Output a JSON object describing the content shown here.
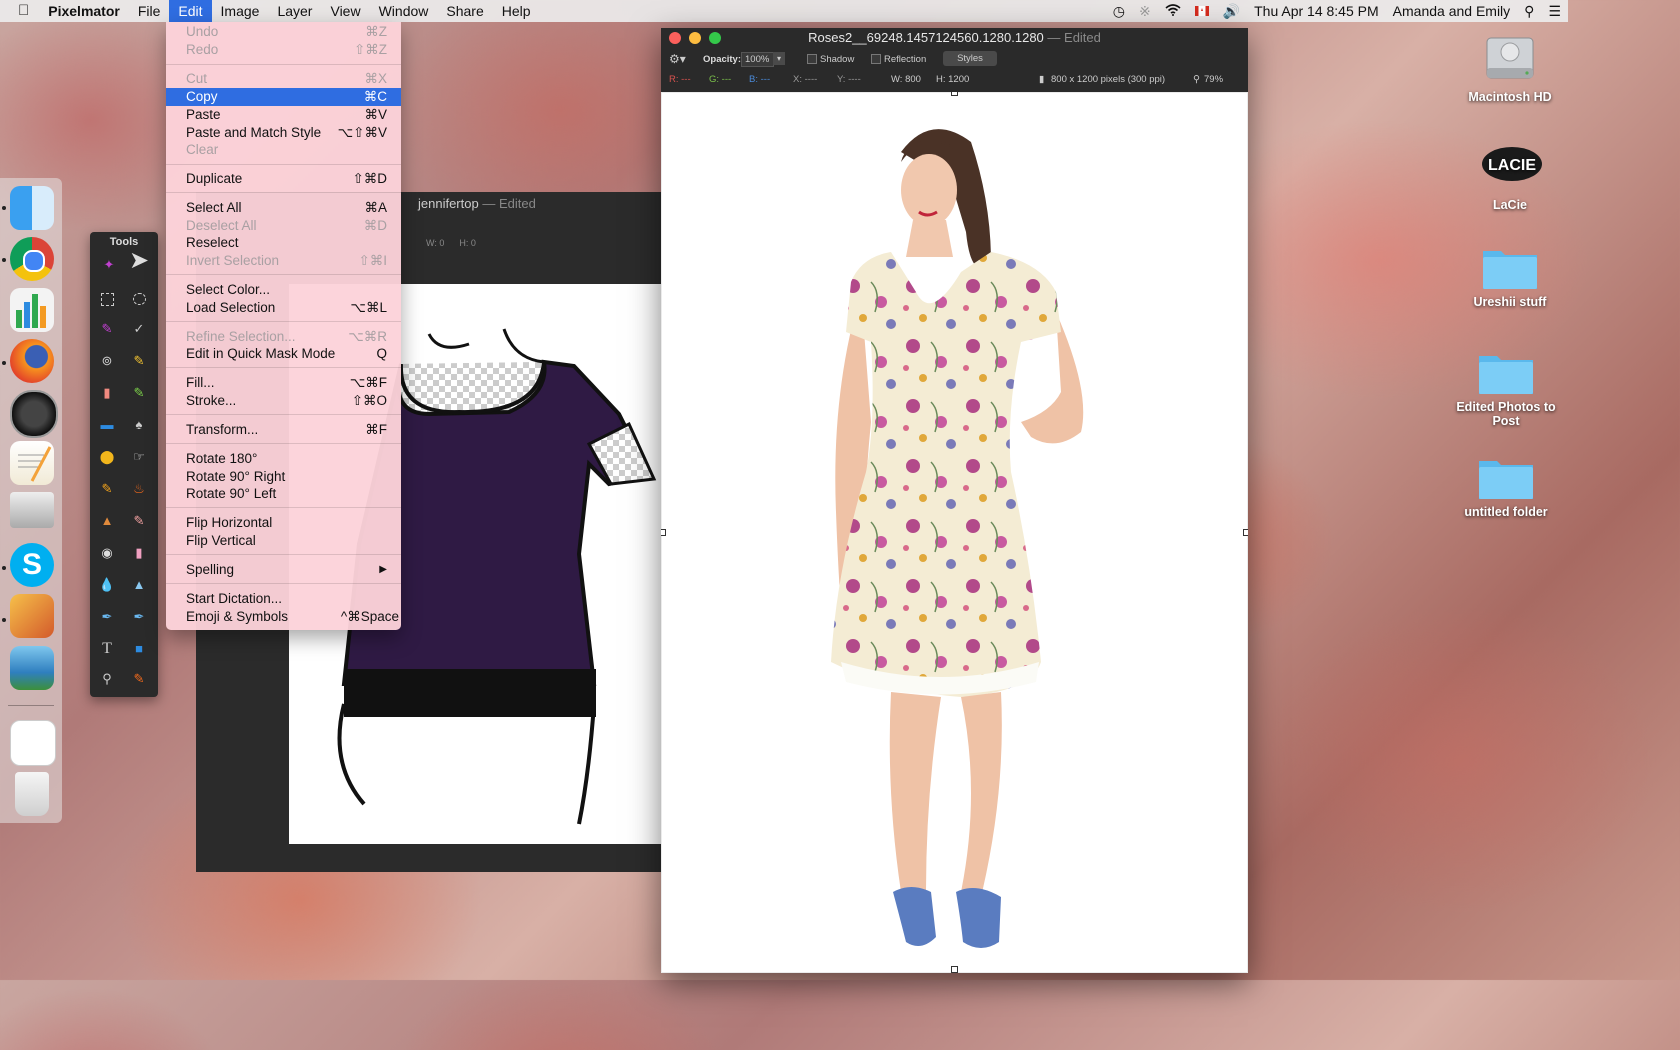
{
  "menubar": {
    "apple": "",
    "app": "Pixelmator",
    "items": [
      "File",
      "Edit",
      "Image",
      "Layer",
      "View",
      "Window",
      "Share",
      "Help"
    ],
    "active": "Edit",
    "clock": "Thu Apr 14  8:45 PM",
    "user": "Amanda and Emily"
  },
  "edit_menu": {
    "items": [
      {
        "label": "Undo",
        "shortcut": "⌘Z",
        "disabled": true
      },
      {
        "label": "Redo",
        "shortcut": "⇧⌘Z",
        "disabled": true
      },
      {
        "label": "Cut",
        "shortcut": "⌘X",
        "disabled": true
      },
      {
        "label": "Copy",
        "shortcut": "⌘C",
        "selected": true
      },
      {
        "label": "Paste",
        "shortcut": "⌘V"
      },
      {
        "label": "Paste and Match Style",
        "shortcut": "⌥⇧⌘V"
      },
      {
        "label": "Clear",
        "shortcut": "",
        "disabled": true
      },
      {
        "label": "Duplicate",
        "shortcut": "⇧⌘D"
      },
      {
        "label": "Select All",
        "shortcut": "⌘A"
      },
      {
        "label": "Deselect All",
        "shortcut": "⌘D",
        "disabled": true
      },
      {
        "label": "Reselect",
        "shortcut": ""
      },
      {
        "label": "Invert Selection",
        "shortcut": "⇧⌘I",
        "disabled": true
      },
      {
        "label": "Select Color...",
        "shortcut": ""
      },
      {
        "label": "Load Selection",
        "shortcut": "⌥⌘L"
      },
      {
        "label": "Refine Selection...",
        "shortcut": "⌥⌘R",
        "disabled": true
      },
      {
        "label": "Edit in Quick Mask Mode",
        "shortcut": "Q"
      },
      {
        "label": "Fill...",
        "shortcut": "⌥⌘F"
      },
      {
        "label": "Stroke...",
        "shortcut": "⇧⌘O"
      },
      {
        "label": "Transform...",
        "shortcut": "⌘F"
      },
      {
        "label": "Rotate 180°",
        "shortcut": ""
      },
      {
        "label": "Rotate 90° Right",
        "shortcut": ""
      },
      {
        "label": "Rotate 90° Left",
        "shortcut": ""
      },
      {
        "label": "Flip Horizontal",
        "shortcut": ""
      },
      {
        "label": "Flip Vertical",
        "shortcut": ""
      },
      {
        "label": "Spelling",
        "shortcut": "▶"
      },
      {
        "label": "Start Dictation...",
        "shortcut": ""
      },
      {
        "label": "Emoji & Symbols",
        "shortcut": "^⌘Space"
      }
    ]
  },
  "tools_palette": {
    "title": "Tools"
  },
  "back_window": {
    "title": "jennifertop",
    "edited": "— Edited",
    "w": "W: 0",
    "h": "H: 0"
  },
  "main_window": {
    "title": "Roses2__69248.1457124560.1280.1280",
    "edited": "— Edited",
    "opacity_label": "Opacity:",
    "opacity_value": "100%",
    "shadow": "Shadow",
    "reflection": "Reflection",
    "styles": "Styles",
    "r": "R: ---",
    "g": "G: ---",
    "b": "B: ---",
    "x": "X: ----",
    "y": "Y: ----",
    "w": "W: 800",
    "h": "H: 1200",
    "size": "800 x 1200 pixels (300 ppi)",
    "zoom": "79%"
  },
  "desktop_icons": [
    "Macintosh HD",
    "LaCie",
    "Ureshii stuff",
    "Edited Photos to Post",
    "untitled folder"
  ],
  "lacie_logo": "LACIE",
  "colors": {
    "menu_highlight": "#2f6de1",
    "menu_bg": "#fcd2da",
    "window_bg": "#2a2a2a",
    "shirt": "#2f1a44"
  }
}
